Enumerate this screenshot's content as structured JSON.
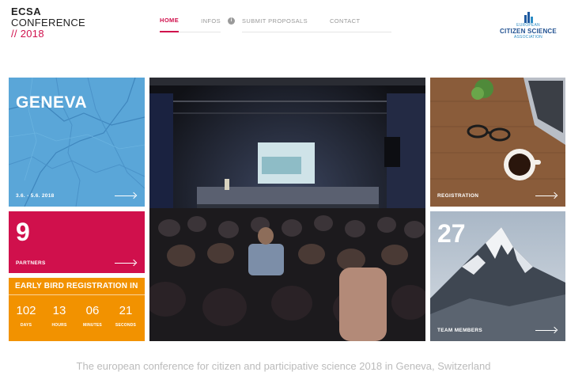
{
  "header": {
    "logo_line1": "ECSA",
    "logo_line2": "CONFERENCE",
    "logo_line3": "// 2018",
    "nav": [
      {
        "label": "HOME"
      },
      {
        "label": "INFOS"
      },
      {
        "label": "SUBMIT PROPOSALS"
      },
      {
        "label": "CONTACT"
      }
    ],
    "info_icon": "info-icon",
    "partner_logo": {
      "line1": "EUROPEAN",
      "line2": "CITIZEN SCIENCE",
      "line3": "ASSOCIATION"
    }
  },
  "tiles": {
    "geneva": {
      "title": "GENEVA",
      "dates": "3.6. - 5.6. 2018"
    },
    "partners": {
      "count": "9",
      "label": "PARTNERS"
    },
    "early_bird": {
      "heading": "EARLY BIRD REGISTRATION IN",
      "countdown": [
        {
          "value": "102",
          "unit": "DAYS"
        },
        {
          "value": "13",
          "unit": "HOURS"
        },
        {
          "value": "06",
          "unit": "MINUTES"
        },
        {
          "value": "21",
          "unit": "SECONDS"
        }
      ]
    },
    "registration": {
      "label": "REGISTRATION"
    },
    "team": {
      "count": "27",
      "label": "TEAM MEMBERS"
    }
  },
  "tagline": "The european conference for citizen and participative science 2018 in Geneva, Switzerland",
  "colors": {
    "accent": "#d0104c",
    "geneva_tile": "#5aa6d8",
    "partners_tile": "#d0104c",
    "early_bird_tile": "#f29200",
    "ecsa_blue": "#1f4f90"
  },
  "icons": [
    "info-icon",
    "arrow-right-icon"
  ]
}
